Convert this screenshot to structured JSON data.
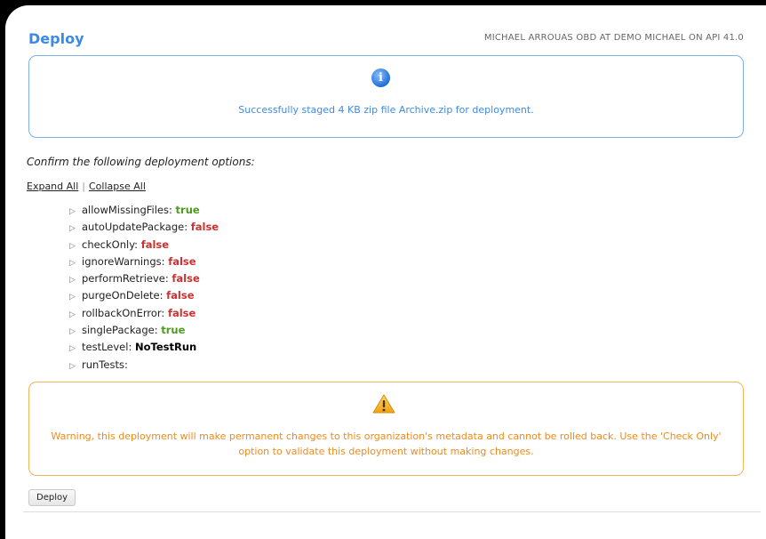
{
  "header": {
    "title": "Deploy",
    "context": "MICHAEL ARROUAS OBD AT DEMO MICHAEL ON API 41.0"
  },
  "info": {
    "icon": "info-icon",
    "icon_glyph": "i",
    "message": "Successfully staged 4 KB zip file Archive.zip for deployment."
  },
  "confirm_text": "Confirm the following deployment options:",
  "links": {
    "expand_all": "Expand All",
    "separator": "|",
    "collapse_all": "Collapse All"
  },
  "options": [
    {
      "name": "allowMissingFiles:",
      "value": "true",
      "type": "true"
    },
    {
      "name": "autoUpdatePackage:",
      "value": "false",
      "type": "false"
    },
    {
      "name": "checkOnly:",
      "value": "false",
      "type": "false"
    },
    {
      "name": "ignoreWarnings:",
      "value": "false",
      "type": "false"
    },
    {
      "name": "performRetrieve:",
      "value": "false",
      "type": "false"
    },
    {
      "name": "purgeOnDelete:",
      "value": "false",
      "type": "false"
    },
    {
      "name": "rollbackOnError:",
      "value": "false",
      "type": "false"
    },
    {
      "name": "singlePackage:",
      "value": "true",
      "type": "true"
    },
    {
      "name": "testLevel:",
      "value": "NoTestRun",
      "type": "other"
    },
    {
      "name": "runTests:",
      "value": "",
      "type": "other"
    }
  ],
  "warning": {
    "icon": "warning-icon",
    "message": "Warning, this deployment will make permanent changes to this organization's metadata and cannot be rolled back. Use the 'Check Only' option to validate this deployment without making changes."
  },
  "deploy_button": "Deploy",
  "colors": {
    "title": "#3d8ae6",
    "info_border": "#7fb0e8",
    "warning_border": "#f2b35a",
    "warning_text": "#f08a1c",
    "true_value": "#4c9c1f",
    "false_value": "#d03030"
  }
}
